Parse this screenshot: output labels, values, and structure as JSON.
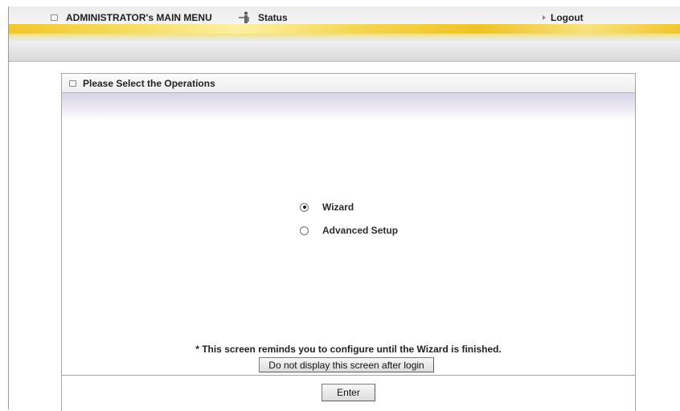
{
  "topbar": {
    "main_menu": "ADMINISTRATOR's MAIN MENU",
    "status": "Status",
    "logout": "Logout",
    "accent_color": "#f3c623"
  },
  "panel": {
    "title": "Please Select the Operations",
    "options": [
      {
        "label": "Wizard",
        "selected": true
      },
      {
        "label": "Advanced Setup",
        "selected": false
      }
    ],
    "reminder": "* This screen reminds you to configure until the Wizard is finished.",
    "no_display_button": "Do not display this screen after login",
    "enter_button": "Enter"
  }
}
